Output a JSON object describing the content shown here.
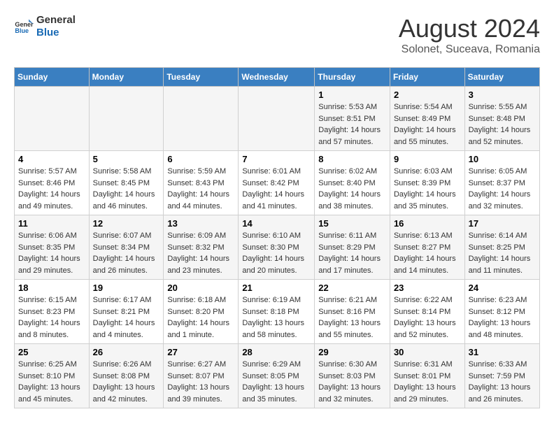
{
  "header": {
    "logo_line1": "General",
    "logo_line2": "Blue",
    "title": "August 2024",
    "subtitle": "Solonet, Suceava, Romania"
  },
  "calendar": {
    "days_of_week": [
      "Sunday",
      "Monday",
      "Tuesday",
      "Wednesday",
      "Thursday",
      "Friday",
      "Saturday"
    ],
    "weeks": [
      [
        {
          "day": "",
          "info": ""
        },
        {
          "day": "",
          "info": ""
        },
        {
          "day": "",
          "info": ""
        },
        {
          "day": "",
          "info": ""
        },
        {
          "day": "1",
          "info": "Sunrise: 5:53 AM\nSunset: 8:51 PM\nDaylight: 14 hours and 57 minutes."
        },
        {
          "day": "2",
          "info": "Sunrise: 5:54 AM\nSunset: 8:49 PM\nDaylight: 14 hours and 55 minutes."
        },
        {
          "day": "3",
          "info": "Sunrise: 5:55 AM\nSunset: 8:48 PM\nDaylight: 14 hours and 52 minutes."
        }
      ],
      [
        {
          "day": "4",
          "info": "Sunrise: 5:57 AM\nSunset: 8:46 PM\nDaylight: 14 hours and 49 minutes."
        },
        {
          "day": "5",
          "info": "Sunrise: 5:58 AM\nSunset: 8:45 PM\nDaylight: 14 hours and 46 minutes."
        },
        {
          "day": "6",
          "info": "Sunrise: 5:59 AM\nSunset: 8:43 PM\nDaylight: 14 hours and 44 minutes."
        },
        {
          "day": "7",
          "info": "Sunrise: 6:01 AM\nSunset: 8:42 PM\nDaylight: 14 hours and 41 minutes."
        },
        {
          "day": "8",
          "info": "Sunrise: 6:02 AM\nSunset: 8:40 PM\nDaylight: 14 hours and 38 minutes."
        },
        {
          "day": "9",
          "info": "Sunrise: 6:03 AM\nSunset: 8:39 PM\nDaylight: 14 hours and 35 minutes."
        },
        {
          "day": "10",
          "info": "Sunrise: 6:05 AM\nSunset: 8:37 PM\nDaylight: 14 hours and 32 minutes."
        }
      ],
      [
        {
          "day": "11",
          "info": "Sunrise: 6:06 AM\nSunset: 8:35 PM\nDaylight: 14 hours and 29 minutes."
        },
        {
          "day": "12",
          "info": "Sunrise: 6:07 AM\nSunset: 8:34 PM\nDaylight: 14 hours and 26 minutes."
        },
        {
          "day": "13",
          "info": "Sunrise: 6:09 AM\nSunset: 8:32 PM\nDaylight: 14 hours and 23 minutes."
        },
        {
          "day": "14",
          "info": "Sunrise: 6:10 AM\nSunset: 8:30 PM\nDaylight: 14 hours and 20 minutes."
        },
        {
          "day": "15",
          "info": "Sunrise: 6:11 AM\nSunset: 8:29 PM\nDaylight: 14 hours and 17 minutes."
        },
        {
          "day": "16",
          "info": "Sunrise: 6:13 AM\nSunset: 8:27 PM\nDaylight: 14 hours and 14 minutes."
        },
        {
          "day": "17",
          "info": "Sunrise: 6:14 AM\nSunset: 8:25 PM\nDaylight: 14 hours and 11 minutes."
        }
      ],
      [
        {
          "day": "18",
          "info": "Sunrise: 6:15 AM\nSunset: 8:23 PM\nDaylight: 14 hours and 8 minutes."
        },
        {
          "day": "19",
          "info": "Sunrise: 6:17 AM\nSunset: 8:21 PM\nDaylight: 14 hours and 4 minutes."
        },
        {
          "day": "20",
          "info": "Sunrise: 6:18 AM\nSunset: 8:20 PM\nDaylight: 14 hours and 1 minute."
        },
        {
          "day": "21",
          "info": "Sunrise: 6:19 AM\nSunset: 8:18 PM\nDaylight: 13 hours and 58 minutes."
        },
        {
          "day": "22",
          "info": "Sunrise: 6:21 AM\nSunset: 8:16 PM\nDaylight: 13 hours and 55 minutes."
        },
        {
          "day": "23",
          "info": "Sunrise: 6:22 AM\nSunset: 8:14 PM\nDaylight: 13 hours and 52 minutes."
        },
        {
          "day": "24",
          "info": "Sunrise: 6:23 AM\nSunset: 8:12 PM\nDaylight: 13 hours and 48 minutes."
        }
      ],
      [
        {
          "day": "25",
          "info": "Sunrise: 6:25 AM\nSunset: 8:10 PM\nDaylight: 13 hours and 45 minutes."
        },
        {
          "day": "26",
          "info": "Sunrise: 6:26 AM\nSunset: 8:08 PM\nDaylight: 13 hours and 42 minutes."
        },
        {
          "day": "27",
          "info": "Sunrise: 6:27 AM\nSunset: 8:07 PM\nDaylight: 13 hours and 39 minutes."
        },
        {
          "day": "28",
          "info": "Sunrise: 6:29 AM\nSunset: 8:05 PM\nDaylight: 13 hours and 35 minutes."
        },
        {
          "day": "29",
          "info": "Sunrise: 6:30 AM\nSunset: 8:03 PM\nDaylight: 13 hours and 32 minutes."
        },
        {
          "day": "30",
          "info": "Sunrise: 6:31 AM\nSunset: 8:01 PM\nDaylight: 13 hours and 29 minutes."
        },
        {
          "day": "31",
          "info": "Sunrise: 6:33 AM\nSunset: 7:59 PM\nDaylight: 13 hours and 26 minutes."
        }
      ]
    ]
  }
}
